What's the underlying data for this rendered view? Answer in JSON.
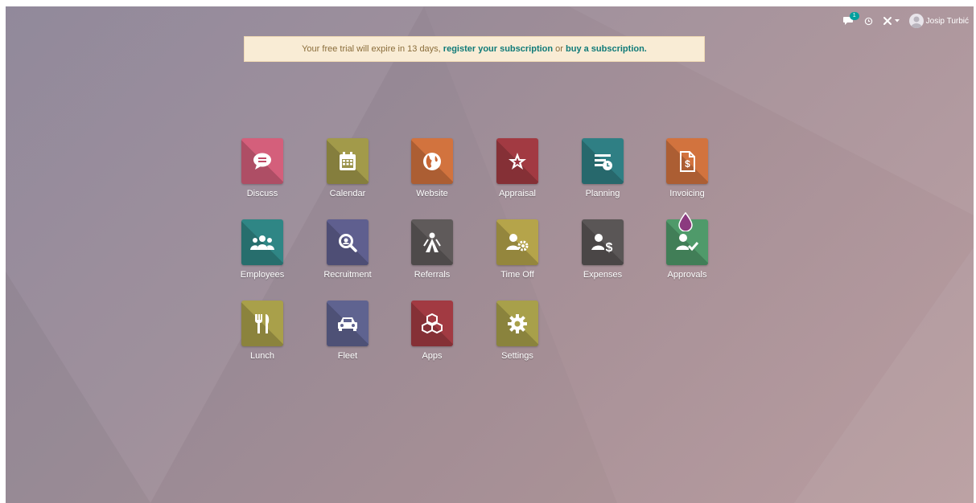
{
  "topbar": {
    "chat_count": "1",
    "user_name": "Josip Turbić"
  },
  "trial_banner": {
    "text_before": "Your free trial will expire in 13 days, ",
    "register_link": "register your subscription",
    "text_middle": " or ",
    "buy_link": "buy a subscription."
  },
  "apps": [
    {
      "label": "Discuss",
      "icon": "chat-bubble-icon",
      "color": "#d45f7b"
    },
    {
      "label": "Calendar",
      "icon": "calendar-icon",
      "color": "#a29a4a"
    },
    {
      "label": "Website",
      "icon": "globe-icon",
      "color": "#d2733e"
    },
    {
      "label": "Appraisal",
      "icon": "star-icon",
      "color": "#a23a42"
    },
    {
      "label": "Planning",
      "icon": "planning-icon",
      "color": "#2f7f84"
    },
    {
      "label": "Invoicing",
      "icon": "invoice-icon",
      "color": "#d2733e"
    },
    {
      "label": "Employees",
      "icon": "people-icon",
      "color": "#2f8685"
    },
    {
      "label": "Recruitment",
      "icon": "magnifier-icon",
      "color": "#5f5f8f"
    },
    {
      "label": "Referrals",
      "icon": "referral-hero-icon",
      "color": "#5f5a5a"
    },
    {
      "label": "Time Off",
      "icon": "user-gear-icon",
      "color": "#b5a44a"
    },
    {
      "label": "Expenses",
      "icon": "user-dollar-icon",
      "color": "#5a5656"
    },
    {
      "label": "Approvals",
      "icon": "user-check-icon",
      "color": "#4f9a6a"
    },
    {
      "label": "Lunch",
      "icon": "cutlery-icon",
      "color": "#a9a04a"
    },
    {
      "label": "Fleet",
      "icon": "car-icon",
      "color": "#5f6390"
    },
    {
      "label": "Apps",
      "icon": "cubes-icon",
      "color": "#a23a42"
    },
    {
      "label": "Settings",
      "icon": "gear-icon",
      "color": "#a8a04a"
    }
  ]
}
